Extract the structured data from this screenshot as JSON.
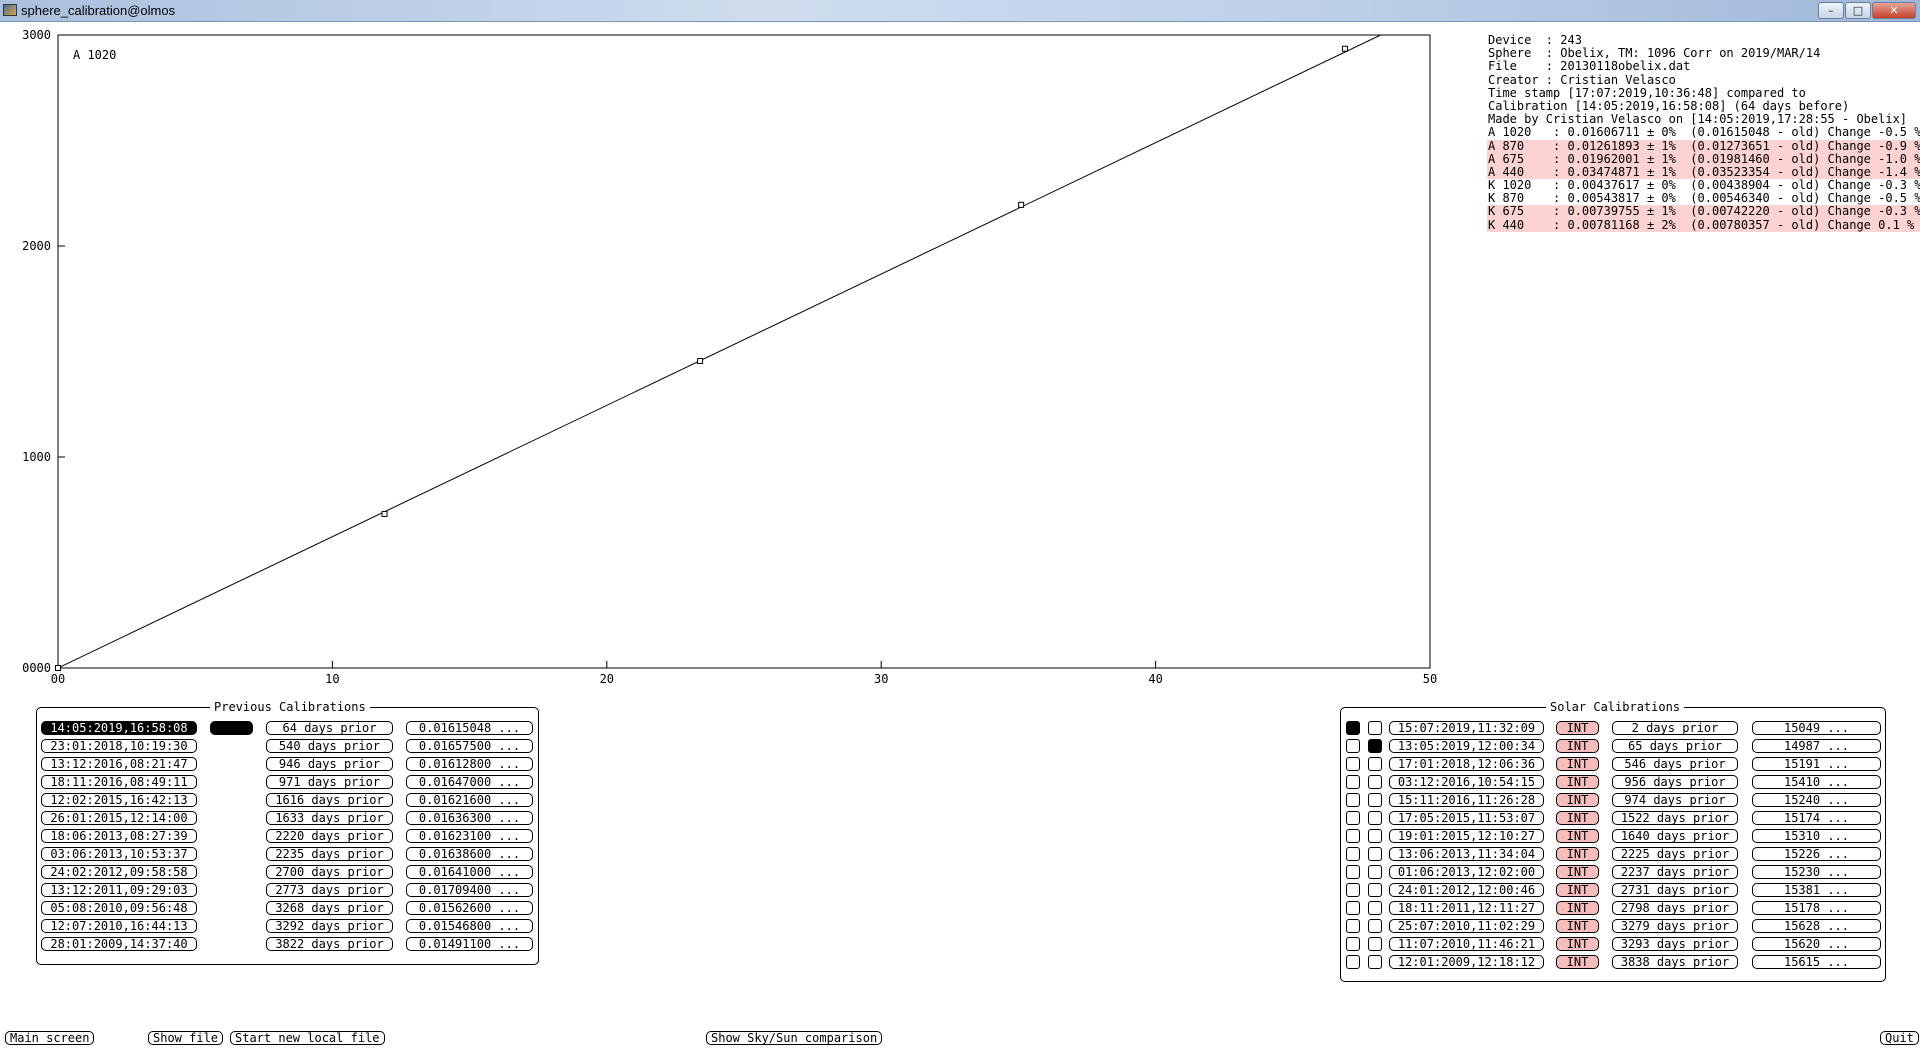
{
  "window": {
    "title": "sphere_calibration@olmos"
  },
  "chart_data": {
    "type": "scatter",
    "label": "A 1020",
    "xlim": [
      0,
      50
    ],
    "ylim": [
      0,
      3000
    ],
    "x_ticks": [
      0,
      10,
      20,
      30,
      40,
      50
    ],
    "x_tick_labels": [
      "00",
      "10",
      "20",
      "30",
      "40",
      "50"
    ],
    "y_ticks": [
      0,
      1000,
      2000,
      3000
    ],
    "y_tick_labels": [
      "0000",
      "1000",
      "2000",
      "3000"
    ],
    "points": [
      {
        "x": 0,
        "y": 0
      },
      {
        "x": 11.9,
        "y": 730
      },
      {
        "x": 23.4,
        "y": 1455
      },
      {
        "x": 35.1,
        "y": 2195
      },
      {
        "x": 46.9,
        "y": 2935
      }
    ],
    "fit_line": {
      "x": [
        0,
        48.2
      ],
      "y": [
        0,
        3000
      ]
    }
  },
  "info": {
    "lines": [
      {
        "text": "Device  : 243",
        "highlight": false
      },
      {
        "text": "Sphere  : Obelix, TM: 1096 Corr on 2019/MAR/14",
        "highlight": false
      },
      {
        "text": "File    : 20130118obelix.dat",
        "highlight": false
      },
      {
        "text": "Creator : Cristian Velasco",
        "highlight": false
      },
      {
        "text": "Time stamp [17:07:2019,10:36:48] compared to",
        "highlight": false
      },
      {
        "text": "Calibration [14:05:2019,16:58:08] (64 days before)",
        "highlight": false
      },
      {
        "text": "Made by Cristian Velasco on [14:05:2019,17:28:55 - Obelix]",
        "highlight": false
      },
      {
        "text": "A 1020   : 0.01606711 ± 0%  (0.01615048 - old) Change -0.5 %",
        "highlight": false
      },
      {
        "text": "A 870    : 0.01261893 ± 1%  (0.01273651 - old) Change -0.9 %",
        "highlight": true
      },
      {
        "text": "A 675    : 0.01962001 ± 1%  (0.01981460 - old) Change -1.0 %",
        "highlight": true
      },
      {
        "text": "A 440    : 0.03474871 ± 1%  (0.03523354 - old) Change -1.4 %",
        "highlight": true
      },
      {
        "text": "K 1020   : 0.00437617 ± 0%  (0.00438904 - old) Change -0.3 %",
        "highlight": false
      },
      {
        "text": "K 870    : 0.00543817 ± 0%  (0.00546340 - old) Change -0.5 %",
        "highlight": false
      },
      {
        "text": "K 675    : 0.00739755 ± 1%  (0.00742220 - old) Change -0.3 %",
        "highlight": true
      },
      {
        "text": "K 440    : 0.00781168 ± 2%  (0.00780357 - old) Change 0.1 %",
        "highlight": true
      }
    ]
  },
  "previous_calibrations": {
    "title": "Previous Calibrations",
    "rows": [
      {
        "date": "14:05:2019,16:58:08",
        "prior": "64 days prior",
        "value": "0.01615048 ...",
        "selected": true
      },
      {
        "date": "23:01:2018,10:19:30",
        "prior": "540 days prior",
        "value": "0.01657500 ...",
        "selected": false
      },
      {
        "date": "13:12:2016,08:21:47",
        "prior": "946 days prior",
        "value": "0.01612800 ...",
        "selected": false
      },
      {
        "date": "18:11:2016,08:49:11",
        "prior": "971 days prior",
        "value": "0.01647000 ...",
        "selected": false
      },
      {
        "date": "12:02:2015,16:42:13",
        "prior": "1616 days prior",
        "value": "0.01621600 ...",
        "selected": false
      },
      {
        "date": "26:01:2015,12:14:00",
        "prior": "1633 days prior",
        "value": "0.01636300 ...",
        "selected": false
      },
      {
        "date": "18:06:2013,08:27:39",
        "prior": "2220 days prior",
        "value": "0.01623100 ...",
        "selected": false
      },
      {
        "date": "03:06:2013,10:53:37",
        "prior": "2235 days prior",
        "value": "0.01638600 ...",
        "selected": false
      },
      {
        "date": "24:02:2012,09:58:58",
        "prior": "2700 days prior",
        "value": "0.01641000 ...",
        "selected": false
      },
      {
        "date": "13:12:2011,09:29:03",
        "prior": "2773 days prior",
        "value": "0.01709400 ...",
        "selected": false
      },
      {
        "date": "05:08:2010,09:56:48",
        "prior": "3268 days prior",
        "value": "0.01562600 ...",
        "selected": false
      },
      {
        "date": "12:07:2010,16:44:13",
        "prior": "3292 days prior",
        "value": "0.01546800 ...",
        "selected": false
      },
      {
        "date": "28:01:2009,14:37:40",
        "prior": "3822 days prior",
        "value": "0.01491100 ...",
        "selected": false
      }
    ]
  },
  "solar_calibrations": {
    "title": "Solar Calibrations",
    "int_label": "INT",
    "rows": [
      {
        "check1": true,
        "check2": false,
        "date": "15:07:2019,11:32:09",
        "prior": "2 days prior",
        "value": "15049 ..."
      },
      {
        "check1": false,
        "check2": true,
        "date": "13:05:2019,12:00:34",
        "prior": "65 days prior",
        "value": "14987 ..."
      },
      {
        "check1": false,
        "check2": false,
        "date": "17:01:2018,12:06:36",
        "prior": "546 days prior",
        "value": "15191 ..."
      },
      {
        "check1": false,
        "check2": false,
        "date": "03:12:2016,10:54:15",
        "prior": "956 days prior",
        "value": "15410 ..."
      },
      {
        "check1": false,
        "check2": false,
        "date": "15:11:2016,11:26:28",
        "prior": "974 days prior",
        "value": "15240 ..."
      },
      {
        "check1": false,
        "check2": false,
        "date": "17:05:2015,11:53:07",
        "prior": "1522 days prior",
        "value": "15174 ..."
      },
      {
        "check1": false,
        "check2": false,
        "date": "19:01:2015,12:10:27",
        "prior": "1640 days prior",
        "value": "15310 ..."
      },
      {
        "check1": false,
        "check2": false,
        "date": "13:06:2013,11:34:04",
        "prior": "2225 days prior",
        "value": "15226 ..."
      },
      {
        "check1": false,
        "check2": false,
        "date": "01:06:2013,12:02:00",
        "prior": "2237 days prior",
        "value": "15230 ..."
      },
      {
        "check1": false,
        "check2": false,
        "date": "24:01:2012,12:00:46",
        "prior": "2731 days prior",
        "value": "15381 ..."
      },
      {
        "check1": false,
        "check2": false,
        "date": "18:11:2011,12:11:27",
        "prior": "2798 days prior",
        "value": "15178 ..."
      },
      {
        "check1": false,
        "check2": false,
        "date": "25:07:2010,11:02:29",
        "prior": "3279 days prior",
        "value": "15628 ..."
      },
      {
        "check1": false,
        "check2": false,
        "date": "11:07:2010,11:46:21",
        "prior": "3293 days prior",
        "value": "15620 ..."
      },
      {
        "check1": false,
        "check2": false,
        "date": "12:01:2009,12:18:12",
        "prior": "3838 days prior",
        "value": "15615 ..."
      }
    ]
  },
  "buttons": {
    "main_screen": "Main screen",
    "show_file": "Show file",
    "start_new_local_file": "Start new local file",
    "show_sky_sun": "Show Sky/Sun comparison",
    "quit": "Quit"
  }
}
